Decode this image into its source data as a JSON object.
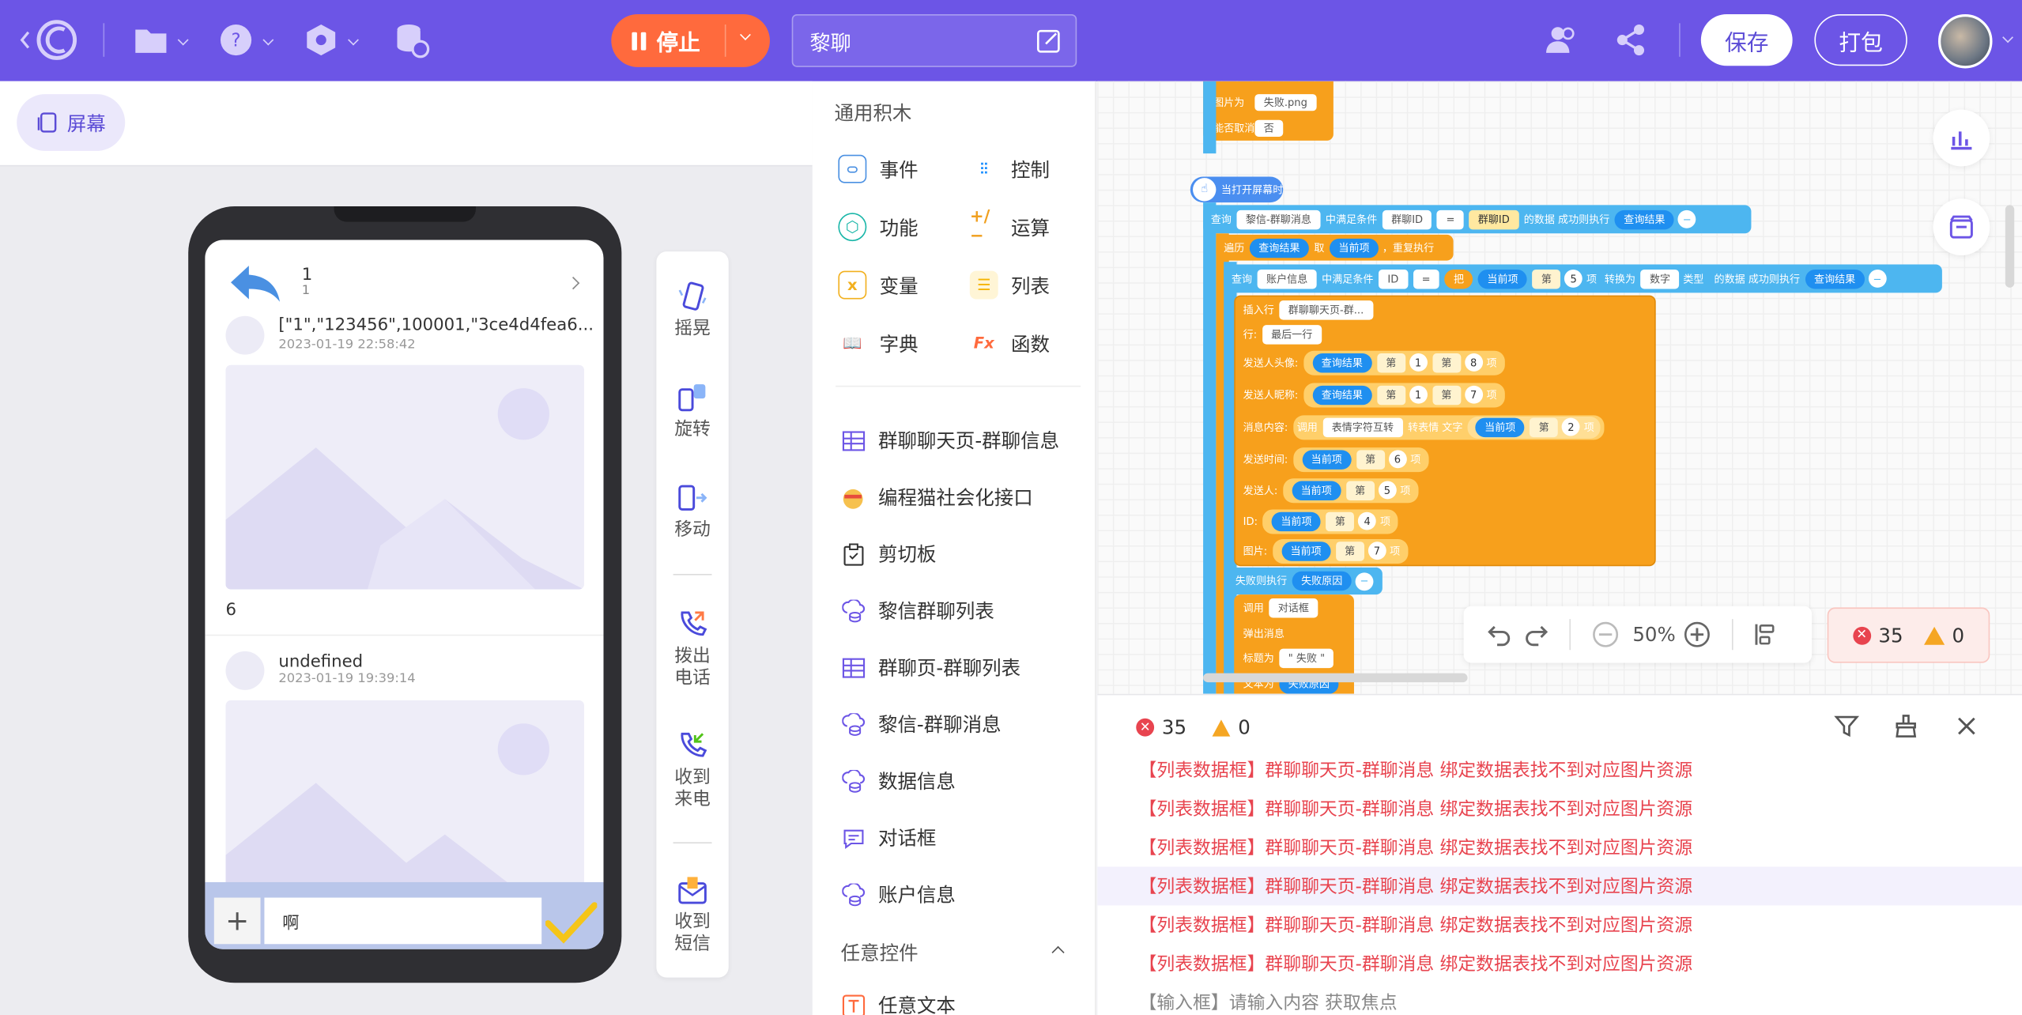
{
  "topbar": {
    "stop_label": "停止",
    "project_name": "黎聊",
    "save_label": "保存",
    "package_label": "打包"
  },
  "left": {
    "screen_label": "屏幕"
  },
  "preview": {
    "header_title": "1",
    "header_subtitle": "1",
    "msg1": {
      "text": "[\"1\",\"123456\",100001,\"3ce4d4fea6...",
      "time": "2023-01-19 22:58:42"
    },
    "count_text": "6",
    "msg2": {
      "text": "undefined",
      "time": "2023-01-19 19:39:14"
    },
    "input_value": "啊"
  },
  "devtools": {
    "items": [
      "摇晃",
      "旋转",
      "移动",
      "拨出\n电话",
      "收到\n来电",
      "收到\n短信"
    ]
  },
  "blocks_panel": {
    "title": "通用积木",
    "categories": [
      {
        "label": "事件",
        "color": "#4a90e2"
      },
      {
        "label": "控制",
        "color": "#1e90ff"
      },
      {
        "label": "功能",
        "color": "#19b6a8"
      },
      {
        "label": "运算",
        "color": "#f0a020"
      },
      {
        "label": "变量",
        "color": "#f2b01e"
      },
      {
        "label": "列表",
        "color": "#f5b400"
      },
      {
        "label": "字典",
        "color": "#6f5be8"
      },
      {
        "label": "函数",
        "color": "#ff6a3d"
      }
    ],
    "items": [
      "群聊聊天页-群聊信息",
      "编程猫社会化接口",
      "剪切板",
      "黎信群聊列表",
      "群聊页-群聊列表",
      "黎信-群聊消息",
      "数据信息",
      "对话框",
      "账户信息"
    ],
    "section": "任意控件",
    "section_item": "任意文本"
  },
  "workspace": {
    "top_fail_img": "图片为",
    "top_fail_img_val": "失败.png",
    "top_cancel": "能否取消",
    "top_cancel_val": "否",
    "event": "当打开屏幕时",
    "query_row": [
      "查询",
      "黎信-群聊消息",
      "中满足条件",
      "群聊ID",
      "=",
      "群聊ID",
      "的数据 成功则执行",
      "查询结果"
    ],
    "loop_row": [
      "遍历",
      "查询结果",
      "取",
      "当前项",
      "，重复执行"
    ],
    "query2_row": [
      "查询",
      "账户信息",
      "中满足条件",
      "ID",
      "=",
      "把",
      "当前项",
      "第",
      "5",
      "项",
      "转换为",
      "数字",
      "类型",
      "的数据 成功则执行",
      "查询结果"
    ],
    "insert_row": [
      "插入行",
      "群聊聊天页-群..."
    ],
    "row_row": [
      "行:",
      "最后一行"
    ],
    "fields": [
      {
        "k": "发送人头像:",
        "a": "查询结果",
        "n1": "1",
        "n2": "8"
      },
      {
        "k": "发送人昵称:",
        "a": "查询结果",
        "n1": "1",
        "n2": "7"
      }
    ],
    "content_row": [
      "消息内容:",
      "调用",
      "表情字符互转",
      "转表情 文字",
      "当前项",
      "第",
      "2",
      "项"
    ],
    "fields2": [
      {
        "k": "发送时间:",
        "a": "当前项",
        "n": "6"
      },
      {
        "k": "发送人:",
        "a": "当前项",
        "n": "5"
      },
      {
        "k": "ID:",
        "a": "当前项",
        "n": "4"
      },
      {
        "k": "图片:",
        "a": "当前项",
        "n": "7"
      }
    ],
    "di": "第",
    "xiang": "项",
    "fail_row": [
      "失败则执行",
      "失败原因"
    ],
    "call_row": [
      "调用",
      "对话框"
    ],
    "popup": "弹出消息",
    "title_row": [
      "标题为",
      "\" 失败 \""
    ],
    "text_row": [
      "文本为",
      "失败原因"
    ]
  },
  "zoom": {
    "level": "50%"
  },
  "errors": {
    "error_count": "35",
    "warning_count": "0"
  },
  "console": {
    "lines": [
      "【列表数据框】群聊聊天页-群聊消息 绑定数据表找不到对应图片资源",
      "【列表数据框】群聊聊天页-群聊消息 绑定数据表找不到对应图片资源",
      "【列表数据框】群聊聊天页-群聊消息 绑定数据表找不到对应图片资源",
      "【列表数据框】群聊聊天页-群聊消息 绑定数据表找不到对应图片资源",
      "【列表数据框】群聊聊天页-群聊消息 绑定数据表找不到对应图片资源",
      "【列表数据框】群聊聊天页-群聊消息 绑定数据表找不到对应图片资源"
    ],
    "last_line": "【输入框】请输入内容 获取焦点"
  },
  "colors": {
    "brand": "#6c55e6",
    "stop": "#ff6a3d",
    "error": "#e8444f",
    "block_orange": "#f7a01c",
    "block_blue": "#4db6f0"
  }
}
